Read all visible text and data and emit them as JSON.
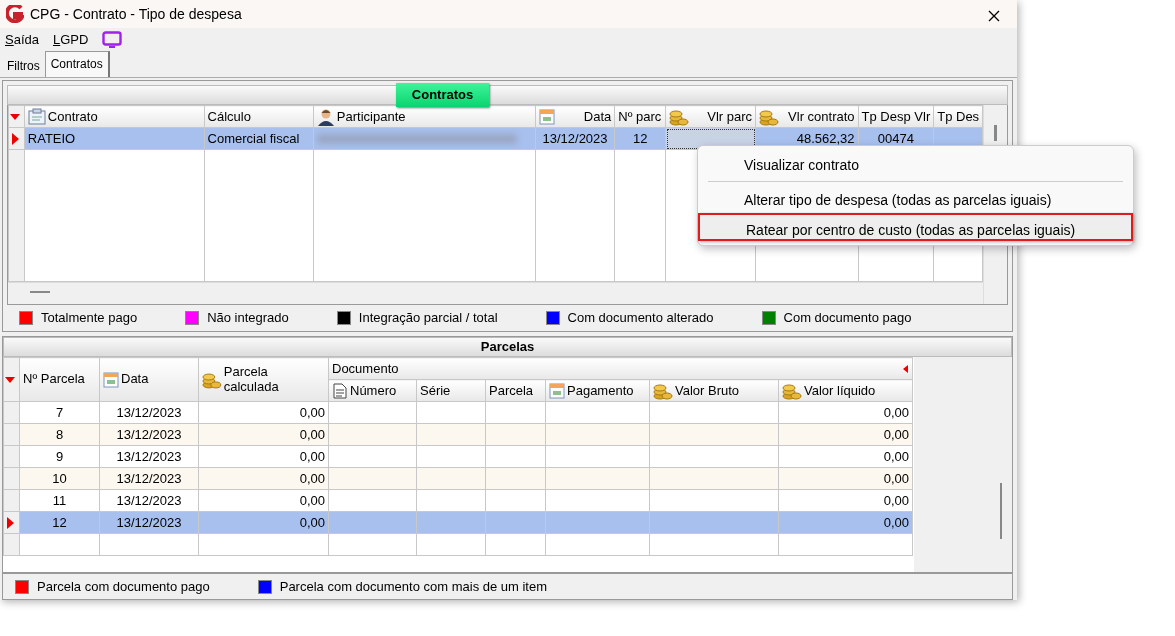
{
  "window": {
    "title": "CPG - Contrato - Tipo de despesa"
  },
  "menu": [
    "Saída",
    "LGPD"
  ],
  "tabs": [
    {
      "label": "Filtros",
      "selected": false
    },
    {
      "label": "Contratos",
      "selected": true
    }
  ],
  "contratos": {
    "title": "Contratos",
    "columns": [
      "Contrato",
      "Cálculo",
      "Participante",
      "Data",
      "Nº parc",
      "Vlr parc",
      "Vlr contrato",
      "Tp Desp Vlr",
      "Tp Des"
    ],
    "rows": [
      {
        "selected": true,
        "cells": [
          {
            "kind": "text",
            "text": "RATEIO"
          },
          {
            "kind": "text",
            "text": "Comercial fiscal"
          },
          {
            "kind": "redacted"
          },
          {
            "kind": "text",
            "text": "13/12/2023"
          },
          {
            "kind": "text",
            "text": "12"
          },
          {
            "kind": "focused"
          },
          {
            "kind": "text",
            "text": "48.562,32"
          },
          {
            "kind": "text",
            "text": "00474"
          },
          {
            "kind": "empty"
          }
        ]
      }
    ]
  },
  "legend": [
    {
      "label": "Totalmente pago",
      "color": "#ff0000"
    },
    {
      "label": "Não integrado",
      "color": "#ff00ff"
    },
    {
      "label": "Integração parcial / total",
      "color": "#000000"
    },
    {
      "label": "Com documento alterado",
      "color": "#0000ff"
    },
    {
      "label": "Com documento pago",
      "color": "#008000"
    }
  ],
  "parcelas": {
    "title": "Parcelas",
    "group": "Documento",
    "columns": [
      "Nº Parcela",
      "Data",
      "Parcela calculada"
    ],
    "group_columns": [
      "Número",
      "Série",
      "Parcela",
      "Pagamento",
      "Valor Bruto",
      "Valor líquido"
    ],
    "rows": [
      {
        "selected": false,
        "cells": [
          "7",
          "13/12/2023",
          "0,00",
          "",
          "",
          "",
          "",
          "",
          "0,00"
        ]
      },
      {
        "selected": false,
        "cells": [
          "8",
          "13/12/2023",
          "0,00",
          "",
          "",
          "",
          "",
          "",
          "0,00"
        ]
      },
      {
        "selected": false,
        "cells": [
          "9",
          "13/12/2023",
          "0,00",
          "",
          "",
          "",
          "",
          "",
          "0,00"
        ]
      },
      {
        "selected": false,
        "cells": [
          "10",
          "13/12/2023",
          "0,00",
          "",
          "",
          "",
          "",
          "",
          "0,00"
        ]
      },
      {
        "selected": false,
        "cells": [
          "11",
          "13/12/2023",
          "0,00",
          "",
          "",
          "",
          "",
          "",
          "0,00"
        ]
      },
      {
        "selected": true,
        "cells": [
          "12",
          "13/12/2023",
          "0,00",
          "",
          "",
          "",
          "",
          "",
          "0,00"
        ]
      }
    ]
  },
  "parcelas_legend": [
    {
      "label": "Parcela com documento pago",
      "color": "#ff0000"
    },
    {
      "label": "Parcela com documento com mais de um item",
      "color": "#0000ff"
    }
  ],
  "context_menu": [
    {
      "kind": "item",
      "label": "Visualizar contrato",
      "highlighted": false
    },
    {
      "kind": "separator"
    },
    {
      "kind": "item",
      "label": "Alterar tipo de despesa (todas as parcelas iguais)",
      "highlighted": false
    },
    {
      "kind": "item",
      "label": "Ratear por centro de custo (todas as parcelas iguais)",
      "highlighted": true
    }
  ]
}
